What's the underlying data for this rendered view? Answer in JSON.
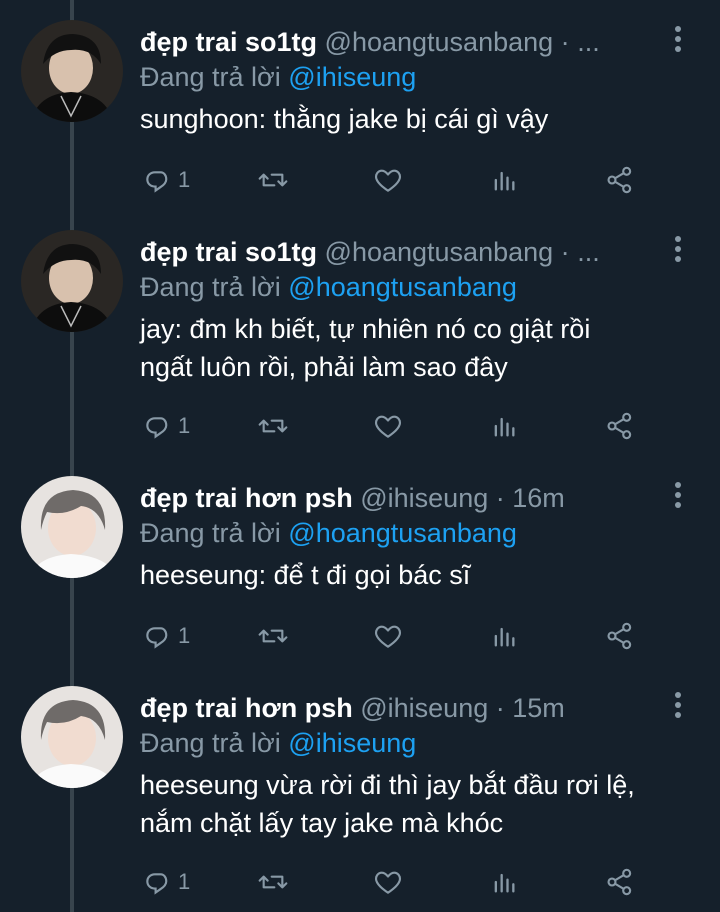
{
  "colors": {
    "background": "#15202b",
    "thread_line": "#38444d",
    "secondary_text": "#8899a6",
    "mention": "#1da1f2",
    "primary_text": "#ffffff"
  },
  "tweets": [
    {
      "display_name": "đẹp trai so1tg",
      "handle": "@hoangtusanbang",
      "separator": "·",
      "time": "...",
      "reply_prefix": "Đang trả lời",
      "reply_to": "@ihiseung",
      "lines": [
        "sunghoon: thằng jake bị cái gì vậy"
      ],
      "reply_count": "1",
      "avatar_icon": "avatar-dark-hair-icon"
    },
    {
      "display_name": "đẹp trai so1tg",
      "handle": "@hoangtusanbang",
      "separator": "·",
      "time": "...",
      "reply_prefix": "Đang trả lời",
      "reply_to": "@hoangtusanbang",
      "lines": [
        "jay: đm kh biết, tự nhiên nó co giật rồi",
        "ngất luôn rồi, phải làm sao đây"
      ],
      "reply_count": "1",
      "avatar_icon": "avatar-dark-hair-icon"
    },
    {
      "display_name": "đẹp trai hơn psh",
      "handle": "@ihiseung",
      "separator": "·",
      "time": "16m",
      "reply_prefix": "Đang trả lời",
      "reply_to": "@hoangtusanbang",
      "lines": [
        "heeseung: để t đi gọi bác sĩ"
      ],
      "reply_count": "1",
      "avatar_icon": "avatar-grey-hair-icon"
    },
    {
      "display_name": "đẹp trai hơn psh",
      "handle": "@ihiseung",
      "separator": "·",
      "time": "15m",
      "reply_prefix": "Đang trả lời",
      "reply_to": "@ihiseung",
      "lines": [
        "heeseung vừa rời đi thì jay bắt đầu rơi lệ,",
        "nắm chặt lấy tay jake mà khóc"
      ],
      "reply_count": "1",
      "avatar_icon": "avatar-grey-hair-icon"
    }
  ],
  "icons": {
    "reply": "reply-icon",
    "retweet": "retweet-icon",
    "like": "heart-icon",
    "analytics": "analytics-icon",
    "share": "share-icon",
    "more": "more-vertical-icon"
  }
}
